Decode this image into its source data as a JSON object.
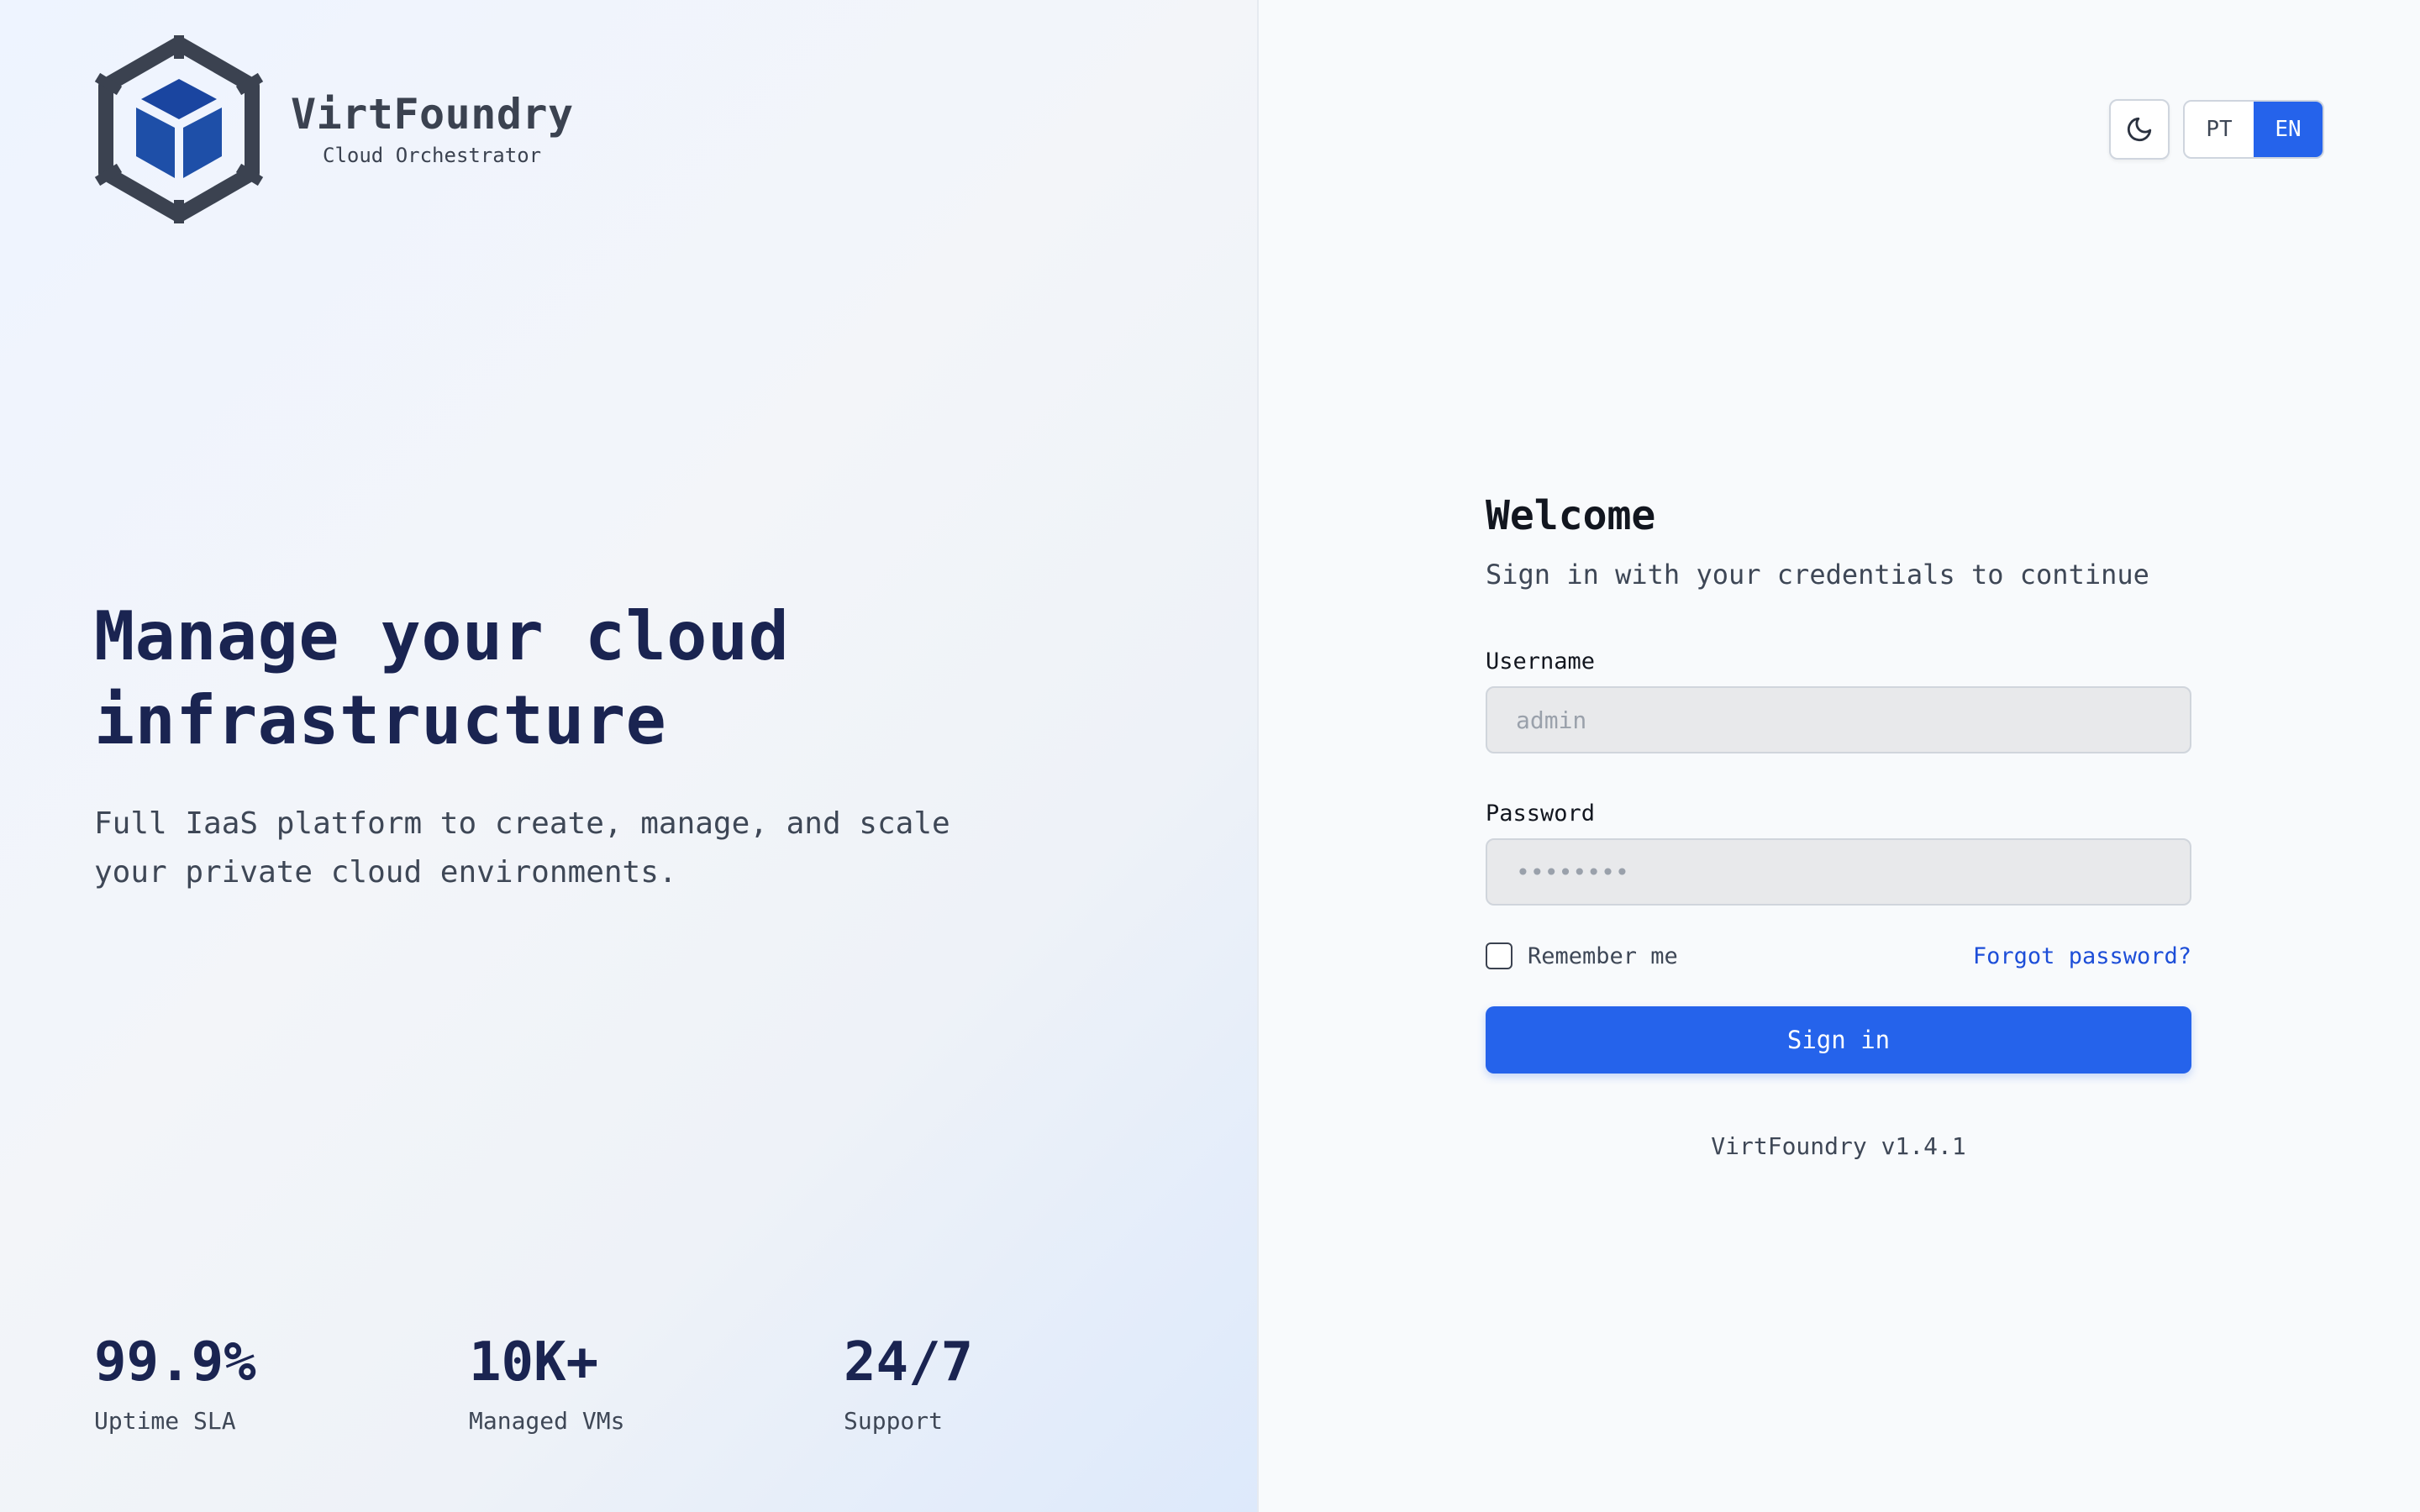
{
  "brand": {
    "name": "VirtFoundry",
    "subtitle": "Cloud Orchestrator",
    "logo_icon": "cube-hexagon-icon",
    "colors": {
      "logo_ring": "#3b4250",
      "logo_cube": "#1e4fa8",
      "accent": "#2563eb"
    }
  },
  "hero": {
    "title_line1": "Manage your cloud",
    "title_line2": "infrastructure",
    "description": "Full IaaS platform to create, manage, and scale your private cloud environments."
  },
  "stats": [
    {
      "value": "99.9%",
      "label": "Uptime SLA"
    },
    {
      "value": "10K+",
      "label": "Managed VMs"
    },
    {
      "value": "24/7",
      "label": "Support"
    }
  ],
  "controls": {
    "theme_icon": "moon-icon",
    "languages": [
      {
        "code": "PT",
        "active": false
      },
      {
        "code": "EN",
        "active": true
      }
    ]
  },
  "login": {
    "title": "Welcome",
    "subtitle": "Sign in with your credentials to continue",
    "username_label": "Username",
    "username_placeholder": "admin",
    "username_value": "",
    "password_label": "Password",
    "password_placeholder": "••••••••",
    "password_value": "",
    "remember_label": "Remember me",
    "remember_checked": false,
    "forgot_label": "Forgot password?",
    "signin_label": "Sign in",
    "version": "VirtFoundry v1.4.1"
  }
}
